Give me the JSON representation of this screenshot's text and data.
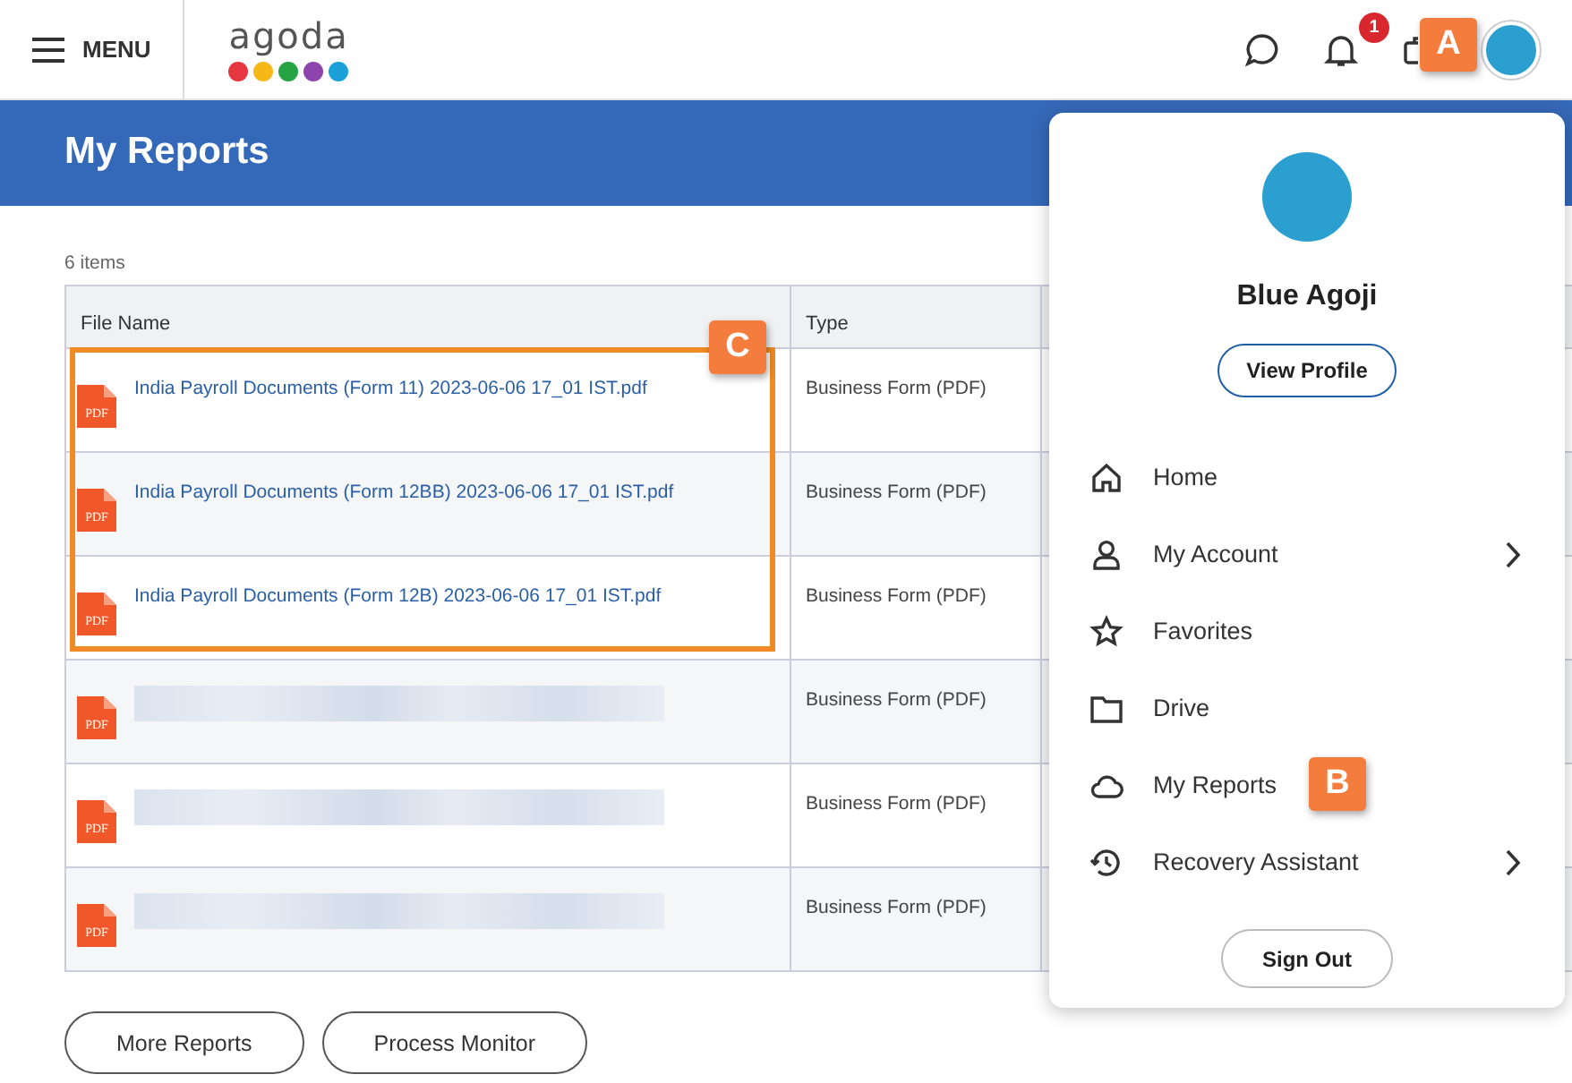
{
  "header": {
    "menu_label": "MENU",
    "logo": "agoda",
    "notifications_count": "1",
    "avatar_callout": "A"
  },
  "page_title": "My Reports",
  "item_count": "6 items",
  "table": {
    "columns": [
      "File Name",
      "Type"
    ],
    "callout": "C",
    "rows": [
      {
        "kind": "file",
        "icon_label": "PDF",
        "name": "India Payroll Documents (Form 11) 2023-06-06 17_01 IST.pdf",
        "type": "Business Form (PDF)",
        "highlighted": true
      },
      {
        "kind": "file",
        "icon_label": "PDF",
        "name": "India Payroll Documents (Form 12BB) 2023-06-06 17_01 IST.pdf",
        "type": "Business Form (PDF)",
        "highlighted": true
      },
      {
        "kind": "file",
        "icon_label": "PDF",
        "name": "India Payroll Documents (Form 12B) 2023-06-06 17_01 IST.pdf",
        "type": "Business Form (PDF)",
        "highlighted": true
      },
      {
        "kind": "redacted",
        "icon_label": "PDF",
        "type": "Business Form (PDF)",
        "highlighted": false
      },
      {
        "kind": "redacted",
        "icon_label": "PDF",
        "type": "Business Form (PDF)",
        "highlighted": false
      },
      {
        "kind": "redacted",
        "icon_label": "PDF",
        "type": "Business Form (PDF)",
        "highlighted": false
      }
    ]
  },
  "buttons": [
    "More Reports",
    "Process Monitor"
  ],
  "profile_menu": {
    "name": "Blue Agoji",
    "view_profile": "View Profile",
    "sign_out": "Sign Out",
    "items": [
      {
        "label": "Home",
        "has_submenu": false
      },
      {
        "label": "My Account",
        "has_submenu": true
      },
      {
        "label": "Favorites",
        "has_submenu": false
      },
      {
        "label": "Drive",
        "has_submenu": false
      },
      {
        "label": "My Reports",
        "has_submenu": false,
        "callout": "B"
      },
      {
        "label": "Recovery Assistant",
        "has_submenu": true
      }
    ]
  }
}
